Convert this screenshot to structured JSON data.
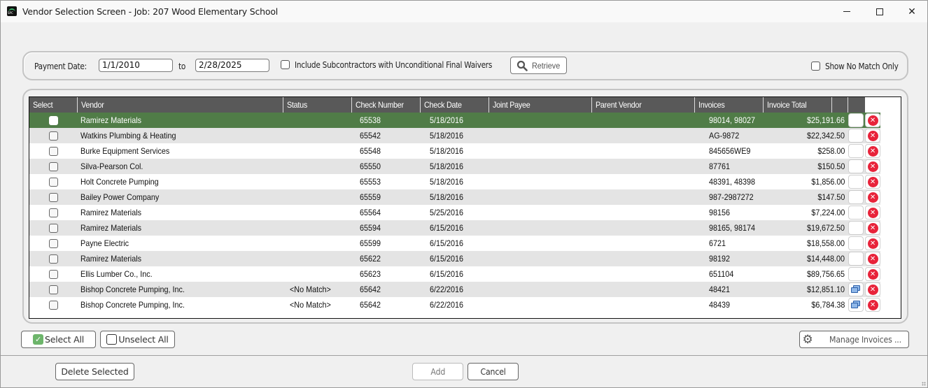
{
  "window": {
    "title": "Vendor Selection Screen - Job: 207 Wood Elementary School",
    "controls": [
      "minimize",
      "maximize",
      "close"
    ]
  },
  "filters": {
    "payment_date_label": "Payment Date:",
    "date_from": "1/1/2010",
    "to_label": "to",
    "date_to": "2/28/2025",
    "include_subs_label": "Include Subcontractors with Unconditional Final Waivers",
    "include_subs_checked": false,
    "retrieve_label": "Retrieve",
    "show_no_match_label": "Show No Match Only",
    "show_no_match_checked": false
  },
  "grid": {
    "columns": [
      "Select",
      "Vendor",
      "Status",
      "Check Number",
      "Check Date",
      "Joint Payee",
      "Parent Vendor",
      "Invoices",
      "Invoice Total",
      "",
      ""
    ],
    "rows": [
      {
        "vendor": "Ramirez Materials",
        "status": "",
        "check_number": "65538",
        "check_date": "5/18/2016",
        "joint_payee": "",
        "parent_vendor": "",
        "invoices": "98014, 98027",
        "invoice_total": "$25,191.66",
        "has_link_icon": false,
        "selected_row": true
      },
      {
        "vendor": "Watkins Plumbing & Heating",
        "status": "",
        "check_number": "65542",
        "check_date": "5/18/2016",
        "joint_payee": "",
        "parent_vendor": "",
        "invoices": "AG-9872",
        "invoice_total": "$22,342.50",
        "has_link_icon": false
      },
      {
        "vendor": "Burke Equipment Services",
        "status": "",
        "check_number": "65548",
        "check_date": "5/18/2016",
        "joint_payee": "",
        "parent_vendor": "",
        "invoices": "845656WE9",
        "invoice_total": "$258.00",
        "has_link_icon": false
      },
      {
        "vendor": "Silva-Pearson Col.",
        "status": "",
        "check_number": "65550",
        "check_date": "5/18/2016",
        "joint_payee": "",
        "parent_vendor": "",
        "invoices": "87761",
        "invoice_total": "$150.50",
        "has_link_icon": false
      },
      {
        "vendor": "Holt Concrete Pumping",
        "status": "",
        "check_number": "65553",
        "check_date": "5/18/2016",
        "joint_payee": "",
        "parent_vendor": "",
        "invoices": "48391, 48398",
        "invoice_total": "$1,856.00",
        "has_link_icon": false
      },
      {
        "vendor": "Bailey Power Company",
        "status": "",
        "check_number": "65559",
        "check_date": "5/18/2016",
        "joint_payee": "",
        "parent_vendor": "",
        "invoices": "987-2987272",
        "invoice_total": "$147.50",
        "has_link_icon": false
      },
      {
        "vendor": "Ramirez Materials",
        "status": "",
        "check_number": "65564",
        "check_date": "5/25/2016",
        "joint_payee": "",
        "parent_vendor": "",
        "invoices": "98156",
        "invoice_total": "$7,224.00",
        "has_link_icon": false
      },
      {
        "vendor": "Ramirez Materials",
        "status": "",
        "check_number": "65594",
        "check_date": "6/15/2016",
        "joint_payee": "",
        "parent_vendor": "",
        "invoices": "98165, 98174",
        "invoice_total": "$19,672.50",
        "has_link_icon": false
      },
      {
        "vendor": "Payne Electric",
        "status": "",
        "check_number": "65599",
        "check_date": "6/15/2016",
        "joint_payee": "",
        "parent_vendor": "",
        "invoices": "6721",
        "invoice_total": "$18,558.00",
        "has_link_icon": false
      },
      {
        "vendor": "Ramirez Materials",
        "status": "",
        "check_number": "65622",
        "check_date": "6/15/2016",
        "joint_payee": "",
        "parent_vendor": "",
        "invoices": "98192",
        "invoice_total": "$14,448.00",
        "has_link_icon": false
      },
      {
        "vendor": "Ellis Lumber Co., Inc.",
        "status": "",
        "check_number": "65623",
        "check_date": "6/15/2016",
        "joint_payee": "",
        "parent_vendor": "",
        "invoices": "651104",
        "invoice_total": "$89,756.65",
        "has_link_icon": false
      },
      {
        "vendor": "Bishop Concrete Pumping, Inc.",
        "status": "<No Match>",
        "check_number": "65642",
        "check_date": "6/22/2016",
        "joint_payee": "",
        "parent_vendor": "",
        "invoices": "48421",
        "invoice_total": "$12,851.10",
        "has_link_icon": true
      },
      {
        "vendor": "Bishop Concrete Pumping, Inc.",
        "status": "<No Match>",
        "check_number": "65642",
        "check_date": "6/22/2016",
        "joint_payee": "",
        "parent_vendor": "",
        "invoices": "48439",
        "invoice_total": "$6,784.38",
        "has_link_icon": true
      }
    ]
  },
  "actions": {
    "select_all": "Select All",
    "unselect_all": "Unselect All",
    "manage_invoices": "Manage Invoices ...",
    "delete_selected": "Delete Selected",
    "add": "Add",
    "cancel": "Cancel"
  },
  "colors": {
    "selected_row": "#507c47",
    "header_bg": "#595959",
    "delete_icon": "#e8233a",
    "alt_row": "#e4e4e4"
  }
}
